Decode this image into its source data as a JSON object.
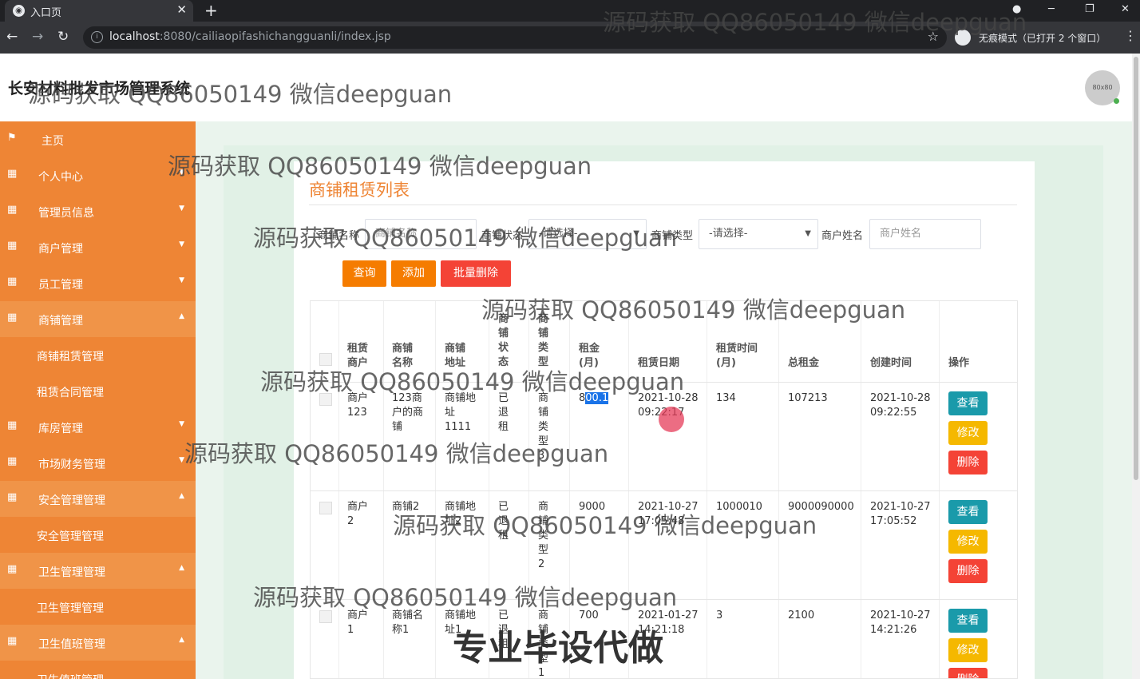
{
  "browser": {
    "tab_title": "入口页",
    "tab_close": "✕",
    "new_tab": "+",
    "win_min": "─",
    "win_max": "❐",
    "win_close": "✕",
    "url_host": "localhost",
    "url_path": ":8080/cailiaopifashichangguanli/index.jsp",
    "incognito_text": "无痕模式（已打开 2 个窗口）"
  },
  "app": {
    "title": "长安材料批发市场管理系统",
    "avatar_text": "80x80"
  },
  "sidebar": {
    "items": [
      {
        "label": "主页",
        "icon": "flag-icon"
      },
      {
        "label": "个人中心",
        "icon": "grid-icon"
      },
      {
        "label": "管理员信息",
        "icon": "grid-icon"
      },
      {
        "label": "商户管理",
        "icon": "grid-icon"
      },
      {
        "label": "员工管理",
        "icon": "grid-icon"
      },
      {
        "label": "商铺管理",
        "icon": "grid-icon"
      },
      {
        "label": "商铺租赁管理"
      },
      {
        "label": "租赁合同管理"
      },
      {
        "label": "库房管理",
        "icon": "grid-icon"
      },
      {
        "label": "市场财务管理",
        "icon": "grid-icon"
      },
      {
        "label": "安全管理管理",
        "icon": "grid-icon"
      },
      {
        "label": "安全管理管理"
      },
      {
        "label": "卫生管理管理",
        "icon": "grid-icon"
      },
      {
        "label": "卫生管理管理"
      },
      {
        "label": "卫生值班管理",
        "icon": "grid-icon"
      },
      {
        "label": "卫生值班管理"
      }
    ]
  },
  "list": {
    "title": "商铺租赁列表",
    "filters": {
      "shop_name_label": "商铺名称",
      "shop_name_placeholder": "商铺名称",
      "status_label": "商铺状态",
      "status_value": "-请选择-",
      "type_label": "商铺类型",
      "type_value": "-请选择-",
      "merchant_label": "商户姓名",
      "merchant_placeholder": "商户姓名"
    },
    "buttons": {
      "query": "查询",
      "add": "添加",
      "batch_delete": "批量删除"
    },
    "columns": [
      "租赁商户",
      "商铺名称",
      "商铺地址",
      "商铺状态",
      "商铺类型",
      "租金(月)",
      "租赁日期",
      "租赁时间(月)",
      "总租金",
      "创建时间",
      "操作"
    ],
    "rows": [
      {
        "merchant": "商户123",
        "shop_name": "123商户的商铺",
        "address": "商铺地址1111",
        "status": "已退租",
        "type": "商铺类型3",
        "rent_pre": "8",
        "rent_hl": "00.1",
        "lease_date": "2021-10-28 09:22:17",
        "lease_months": "134",
        "total": "107213",
        "created": "2021-10-28 09:22:55"
      },
      {
        "merchant": "商户2",
        "shop_name": "商铺2",
        "address": "商铺地址2",
        "status": "已退租",
        "type": "商铺类型2",
        "rent_pre": "9000",
        "rent_hl": "",
        "lease_date": "2021-10-27 17:05:48",
        "lease_months": "1000010",
        "total": "9000090000",
        "created": "2021-10-27 17:05:52"
      },
      {
        "merchant": "商户1",
        "shop_name": "商铺名称1",
        "address": "商铺地址1",
        "status": "已退租",
        "type": "商铺类型1",
        "rent_pre": "700",
        "rent_hl": "",
        "lease_date": "2021-01-27 14:21:18",
        "lease_months": "3",
        "total": "2100",
        "created": "2021-10-27 14:21:26"
      }
    ],
    "actions": {
      "view": "查看",
      "edit": "修改",
      "delete": "删除"
    }
  },
  "watermark": {
    "text": "源码获取 QQ86050149 微信deepguan",
    "banner": "专业毕设代做"
  },
  "colors": {
    "sidebar": "#ee8535",
    "accent": "#ee8535",
    "query_btn": "#f57c00",
    "delete_btn": "#f44336",
    "view_btn": "#1a9aaa",
    "edit_btn": "#f5b800"
  }
}
